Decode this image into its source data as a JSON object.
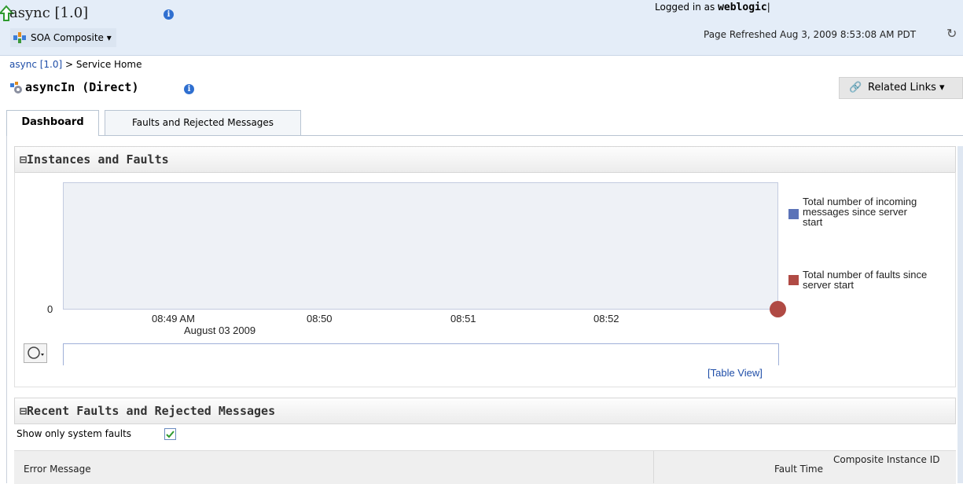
{
  "header": {
    "app_title": "async [1.0]",
    "soa_menu_label": "SOA Composite ▾",
    "logged_in_prefix": "Logged in as",
    "logged_in_user": "weblogic",
    "page_refreshed": "Page Refreshed Aug 3, 2009 8:53:08 AM PDT"
  },
  "breadcrumb": {
    "link": "async [1.0]",
    "separator": " > ",
    "current": "Service Home"
  },
  "service": {
    "title": "asyncIn (Direct)",
    "related_links_label": "Related Links ▾"
  },
  "tabs": [
    {
      "label": "Dashboard",
      "selected": true
    },
    {
      "label": "Faults and Rejected Messages",
      "selected": false
    }
  ],
  "instances_panel": {
    "title": "Instances and Faults",
    "table_view_link": "[Table View]"
  },
  "faults_panel": {
    "title": "Recent Faults and Rejected Messages",
    "show_only_label": "Show only system faults",
    "show_only_checked": true,
    "columns": [
      "Error Message",
      "Fault Time",
      "Composite Instance ID"
    ]
  },
  "colors": {
    "incoming": "#5b73b8",
    "faults": "#b04a44",
    "header_bg": "#e4edf8"
  },
  "chart_data": {
    "type": "line",
    "x_ticks": [
      "08:49 AM",
      "08:50",
      "08:51",
      "08:52"
    ],
    "x_sub_label": "August 03 2009",
    "y_ticks": [
      "0"
    ],
    "series": [
      {
        "name": "Total number of incoming messages since server start",
        "values": [
          0
        ]
      },
      {
        "name": "Total number of faults since server start",
        "values": [
          0
        ]
      }
    ],
    "legend_position": "right"
  }
}
